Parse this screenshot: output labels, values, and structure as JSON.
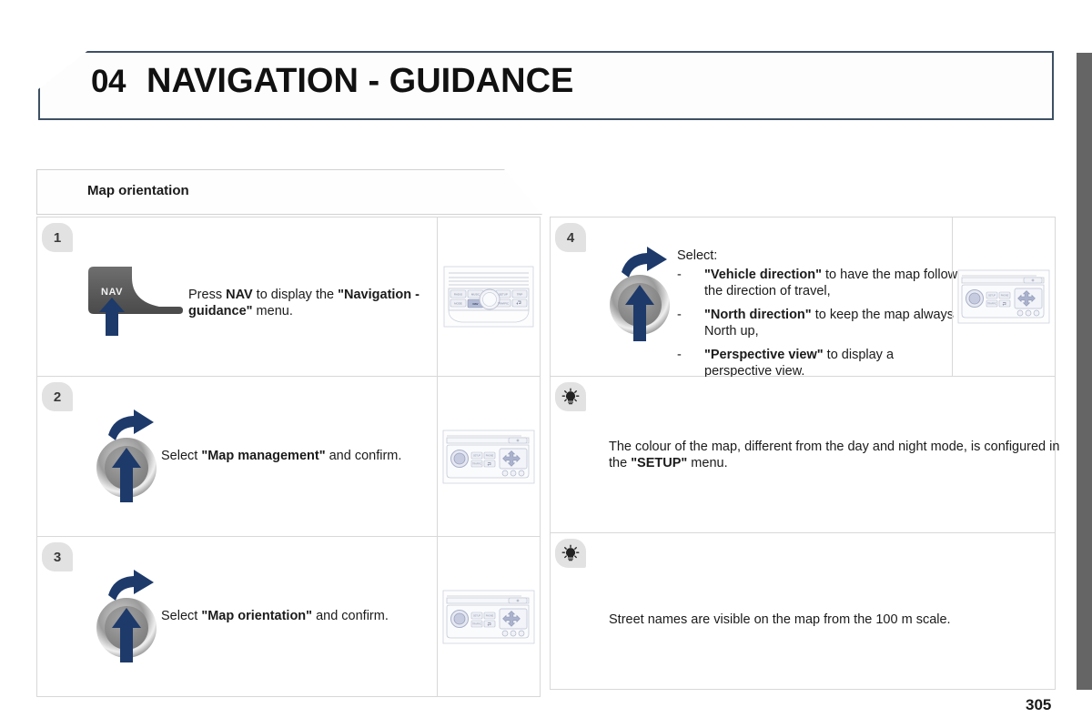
{
  "chapter": {
    "number": "04",
    "title": "NAVIGATION - GUIDANCE"
  },
  "section": {
    "title": "Map orientation"
  },
  "page_number": "305",
  "left_column": {
    "steps": [
      {
        "number": "1",
        "text_parts": [
          {
            "t": "Press ",
            "b": false
          },
          {
            "t": "NAV",
            "b": true
          },
          {
            "t": " to display the ",
            "b": false
          },
          {
            "t": "\"Navigation - guidance\"",
            "b": true
          },
          {
            "t": " menu.",
            "b": false
          }
        ],
        "graphic": "nav-key-icon",
        "picture": "radio-faceplate-nav-highlighted"
      },
      {
        "number": "2",
        "text_parts": [
          {
            "t": "Select ",
            "b": false
          },
          {
            "t": "\"Map management\"",
            "b": true
          },
          {
            "t": " and confirm.",
            "b": false
          }
        ],
        "graphic": "rotary-knob-icon",
        "picture": "radio-panel-with-dpad"
      },
      {
        "number": "3",
        "text_parts": [
          {
            "t": "Select ",
            "b": false
          },
          {
            "t": "\"Map orientation\"",
            "b": true
          },
          {
            "t": " and confirm.",
            "b": false
          }
        ],
        "graphic": "rotary-knob-icon",
        "picture": "radio-panel-with-dpad"
      }
    ]
  },
  "right_column": {
    "step4": {
      "number": "4",
      "lead": "Select:",
      "graphic": "rotary-knob-icon",
      "picture": "radio-panel-with-dpad",
      "bullets": [
        {
          "dash": "-",
          "parts": [
            {
              "t": "\"Vehicle direction\"",
              "b": true
            },
            {
              "t": " to have the map follow the direction of travel,",
              "b": false
            }
          ]
        },
        {
          "dash": "-",
          "parts": [
            {
              "t": "\"North direction\"",
              "b": true
            },
            {
              "t": " to keep the map always North up,",
              "b": false
            }
          ]
        },
        {
          "dash": "-",
          "parts": [
            {
              "t": "\"Perspective view\"",
              "b": true
            },
            {
              "t": " to display a perspective view.",
              "b": false
            }
          ]
        }
      ]
    },
    "tips": [
      {
        "icon": "lightbulb-icon",
        "parts": [
          {
            "t": "The colour of the map, different from the day and night mode, is configured in the ",
            "b": false
          },
          {
            "t": "\"SETUP\"",
            "b": true
          },
          {
            "t": " menu.",
            "b": false
          }
        ]
      },
      {
        "icon": "lightbulb-icon",
        "parts": [
          {
            "t": "Street names are visible on the map from the 100 m scale.",
            "b": false
          }
        ]
      }
    ]
  },
  "radio_faceplate": {
    "buttons_top": [
      "RADIO",
      "MUSIC",
      "SETUP",
      "TRIP"
    ],
    "buttons_bottom": [
      "MODE",
      "NAV",
      "TRAFFIC"
    ],
    "highlighted_button": "NAV"
  },
  "colors": {
    "header_border": "#3d4f63",
    "edge_bar": "#656565",
    "badge_bg": "#e2e2e2",
    "arrow_blue": "#1d3a6b",
    "knob_gray": "#8a8a8a",
    "nav_key_gray": "#5d5d5d",
    "table_border": "#d8d8d8"
  }
}
